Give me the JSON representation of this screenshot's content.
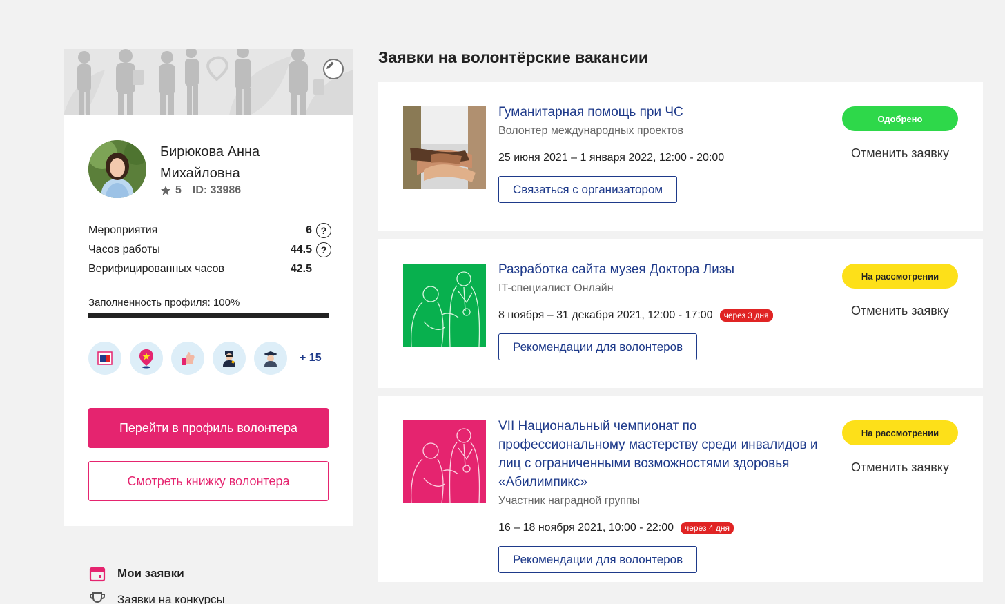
{
  "profile": {
    "name": "Бирюкова Анна Михайловна",
    "rating": "5",
    "id_label": "ID: 33986",
    "stats": [
      {
        "label": "Мероприятия",
        "value": "6",
        "has_help": true
      },
      {
        "label": "Часов работы",
        "value": "44.5",
        "has_help": true
      },
      {
        "label": "Верифицированных часов",
        "value": "42.5",
        "has_help": false
      }
    ],
    "completeness_label": "Заполненность профиля: 100%",
    "completeness_fraction": 1.0,
    "badges": [
      "letter-badge-icon",
      "map-pin-star-badge-icon",
      "thumbs-up-badge-icon",
      "police-officer-badge-icon",
      "graduate-badge-icon"
    ],
    "badges_more": "+ 15",
    "primary_button": "Перейти в профиль волонтера",
    "secondary_button": "Смотреть книжку волонтера"
  },
  "nav": {
    "items": [
      {
        "label": "Мои заявки",
        "icon": "calendar-icon",
        "active": true
      },
      {
        "label": "Заявки на конкурсы",
        "icon": "trophy-icon",
        "active": false
      }
    ]
  },
  "main": {
    "title": "Заявки на волонтёрские вакансии",
    "vacancies": [
      {
        "title": "Гуманитарная помощь при ЧС",
        "role": "Волонтер международных проектов",
        "date": "25 июня 2021 – 1 января 2022, 12:00 - 20:00",
        "deadline": "",
        "button": "Связаться с организатором",
        "status": "Одобрено",
        "status_type": "approved",
        "cancel": "Отменить заявку",
        "thumb": "hands-photo"
      },
      {
        "title": "Разработка сайта музея Доктора Лизы",
        "role": "IT-специалист Онлайн",
        "date": "8 ноября – 31 декабря 2021, 12:00 - 17:00",
        "deadline": "через 3 дня",
        "button": "Рекомендации для волонтеров",
        "status": "На рассмотрении",
        "status_type": "review",
        "cancel": "Отменить заявку",
        "thumb": "green-line-art",
        "thumb_color": "#08b04e"
      },
      {
        "title": "VII Национальный чемпионат по профессиональному мастерству среди инвалидов и лиц с ограниченными возможностями здоровья «Абилимпикс»",
        "role": "Участник наградной группы",
        "date": "16 – 18 ноября 2021, 10:00 - 22:00",
        "deadline": "через 4 дня",
        "button": "Рекомендации для волонтеров",
        "status": "На рассмотрении",
        "status_type": "review",
        "cancel": "Отменить заявку",
        "thumb": "pink-line-art",
        "thumb_color": "#e5246f"
      }
    ]
  }
}
